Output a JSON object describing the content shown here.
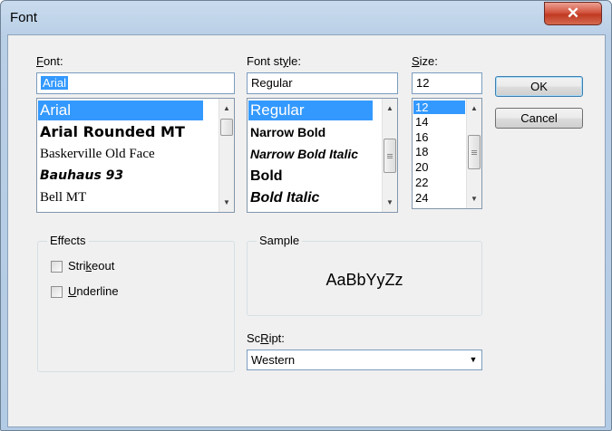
{
  "window": {
    "title": "Font",
    "close_glyph": "✕"
  },
  "font": {
    "label": "Font:",
    "label_access": "F",
    "label_rest": "ont:",
    "value": "Arial",
    "items": [
      "Arial",
      "Arial Rounded MT",
      "Baskerville Old Face",
      "Bauhaus 93",
      "Bell MT"
    ],
    "selected_index": 0
  },
  "style": {
    "label": "Font style:",
    "label_pre": "Font st",
    "label_access": "y",
    "label_rest": "le:",
    "value": "Regular",
    "items": [
      "Regular",
      "Narrow Bold",
      "Narrow Bold Italic",
      "Bold",
      "Bold Italic"
    ],
    "selected_index": 0
  },
  "size": {
    "label": "Size:",
    "label_access": "S",
    "label_rest": "ize:",
    "value": "12",
    "items": [
      "12",
      "14",
      "16",
      "18",
      "20",
      "22",
      "24"
    ],
    "selected_index": 0
  },
  "buttons": {
    "ok": "OK",
    "cancel": "Cancel"
  },
  "effects": {
    "title": "Effects",
    "strikeout_pre": "Stri",
    "strikeout_access": "k",
    "strikeout_rest": "eout",
    "strikeout_checked": false,
    "underline_access": "U",
    "underline_rest": "nderline",
    "underline_checked": false
  },
  "sample": {
    "title": "Sample",
    "text": "AaBbYyZz"
  },
  "script": {
    "label_access": "R",
    "label_pre": "Sc",
    "label_rest": "ipt:",
    "value": "Western"
  },
  "colors": {
    "selection": "#3399ff",
    "close_button": "#c94a31"
  }
}
